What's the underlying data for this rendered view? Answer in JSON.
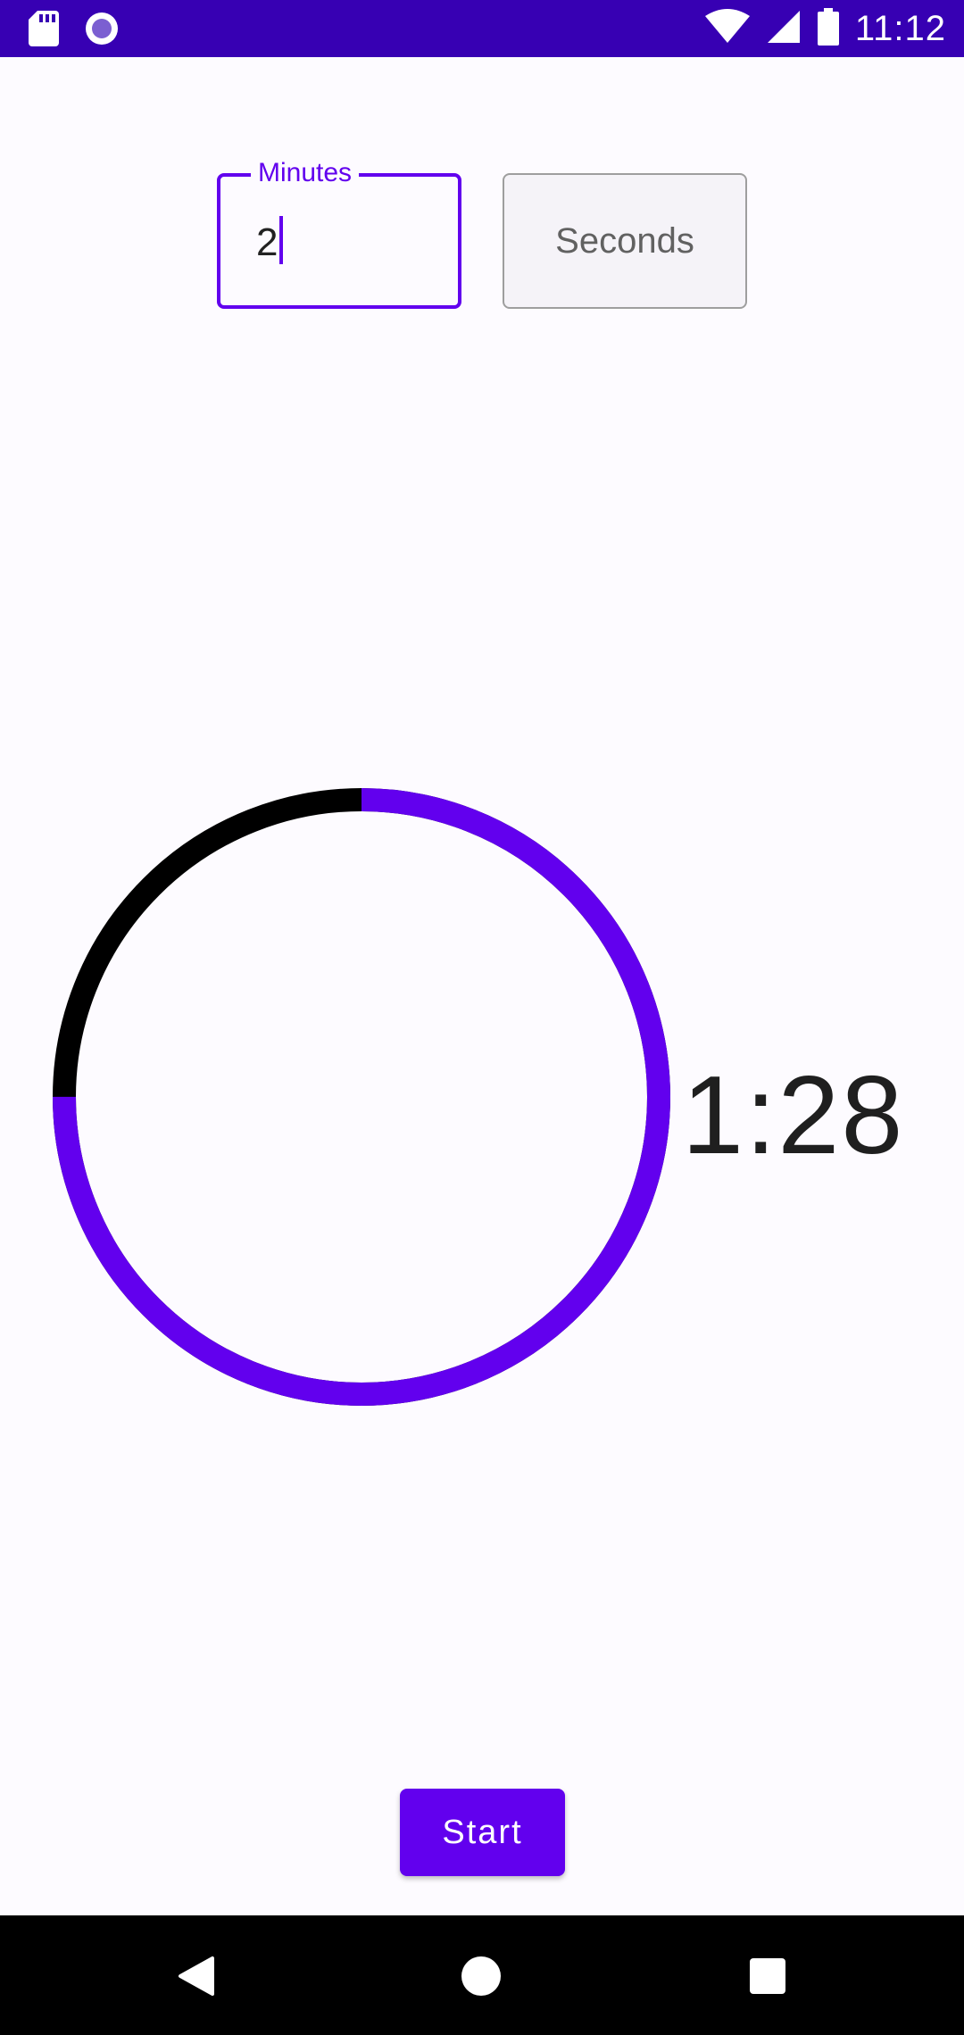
{
  "status_bar": {
    "time": "11:12",
    "icons": [
      "sd-card-icon",
      "record-icon",
      "wifi-icon",
      "cell-signal-icon",
      "battery-icon"
    ],
    "background": "#3700b3"
  },
  "inputs": {
    "minutes": {
      "label": "Minutes",
      "value": "2"
    },
    "seconds": {
      "placeholder": "Seconds"
    }
  },
  "timer": {
    "display": "1:28",
    "progress_colored_fraction": 0.75,
    "ring_color": "#6200ee",
    "remainder_color": "#000000"
  },
  "start_button": {
    "label": "Start",
    "color": "#6200ee"
  },
  "nav_bar": {
    "buttons": [
      "back-icon",
      "home-icon",
      "recents-icon"
    ]
  }
}
